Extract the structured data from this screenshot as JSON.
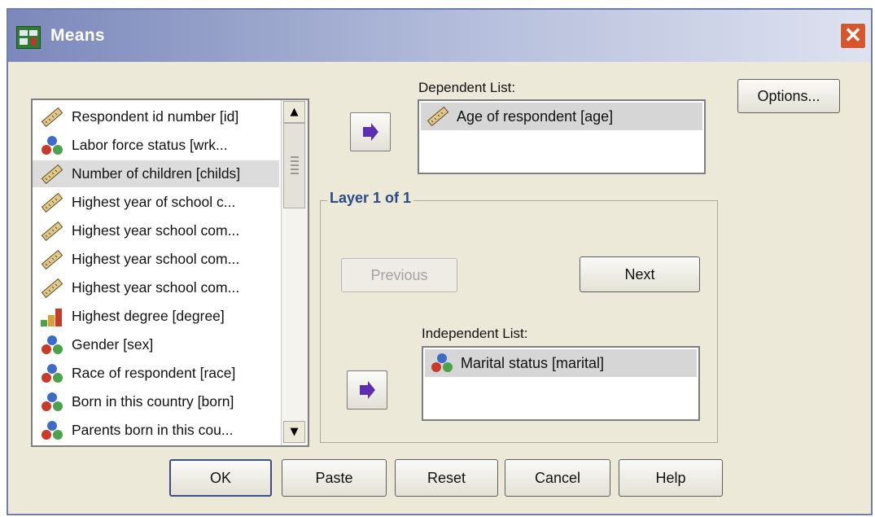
{
  "window": {
    "title": "Means",
    "close_label": "✕"
  },
  "variable_list": {
    "items": [
      {
        "label": "Respondent id number [id]",
        "icon": "ruler-icon"
      },
      {
        "label": "Labor force status [wrk...",
        "icon": "nominal-icon"
      },
      {
        "label": "Number of children [childs]",
        "icon": "ruler-icon",
        "selected": true
      },
      {
        "label": "Highest year of school c...",
        "icon": "ruler-icon"
      },
      {
        "label": "Highest year school com...",
        "icon": "ruler-icon"
      },
      {
        "label": "Highest year school com...",
        "icon": "ruler-icon"
      },
      {
        "label": "Highest year school com...",
        "icon": "ruler-icon"
      },
      {
        "label": "Highest degree [degree]",
        "icon": "ordinal-icon"
      },
      {
        "label": "Gender [sex]",
        "icon": "nominal-icon"
      },
      {
        "label": "Race of respondent [race]",
        "icon": "nominal-icon"
      },
      {
        "label": "Born in this country [born]",
        "icon": "nominal-icon"
      },
      {
        "label": "Parents born in this cou...",
        "icon": "nominal-icon"
      }
    ]
  },
  "dependent": {
    "label": "Dependent List:",
    "items": [
      {
        "label": "Age of respondent [age]",
        "icon": "ruler-icon"
      }
    ]
  },
  "layer": {
    "title": "Layer 1 of 1",
    "previous_label": "Previous",
    "next_label": "Next",
    "independent_label": "Independent List:",
    "items": [
      {
        "label": "Marital status [marital]",
        "icon": "nominal-icon"
      }
    ]
  },
  "buttons": {
    "options": "Options...",
    "ok": "OK",
    "paste": "Paste",
    "reset": "Reset",
    "cancel": "Cancel",
    "help": "Help"
  },
  "colors": {
    "title_gradient_start": "#7b88ba",
    "dialog_background": "#ece9d8",
    "arrow": "#5b2fb0",
    "layer_title": "#2a4a86"
  }
}
